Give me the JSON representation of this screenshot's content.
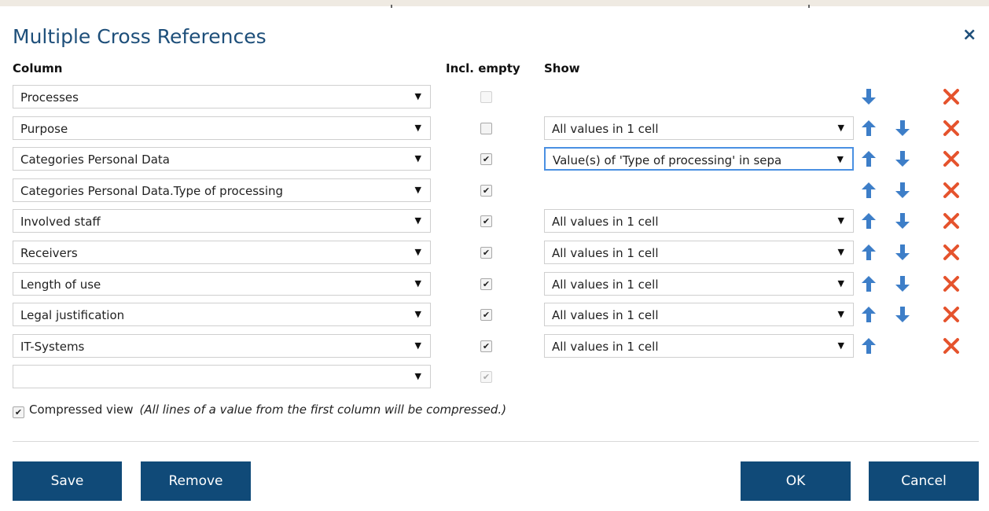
{
  "dialog": {
    "title": "Multiple Cross References",
    "close_glyph": "×"
  },
  "headers": {
    "column": "Column",
    "incl_empty": "Incl. empty",
    "show": "Show"
  },
  "rows": [
    {
      "column": "Processes",
      "incl_empty": false,
      "incl_disabled": true,
      "show": "",
      "up": false,
      "down": true
    },
    {
      "column": "Purpose",
      "incl_empty": false,
      "incl_disabled": false,
      "show": "All values in 1 cell",
      "up": true,
      "down": true
    },
    {
      "column": "Categories Personal Data",
      "incl_empty": true,
      "incl_disabled": false,
      "show": "Value(s) of 'Type of processing' in sepa",
      "show_focused": true,
      "up": true,
      "down": true
    },
    {
      "column": "Categories Personal Data.Type of processing",
      "incl_empty": true,
      "incl_disabled": false,
      "show": "",
      "up": true,
      "down": true
    },
    {
      "column": "Involved staff",
      "incl_empty": true,
      "incl_disabled": false,
      "show": "All values in 1 cell",
      "up": true,
      "down": true
    },
    {
      "column": "Receivers",
      "incl_empty": true,
      "incl_disabled": false,
      "show": "All values in 1 cell",
      "up": true,
      "down": true
    },
    {
      "column": "Length of use",
      "incl_empty": true,
      "incl_disabled": false,
      "show": "All values in 1 cell",
      "up": true,
      "down": true
    },
    {
      "column": "Legal justification",
      "incl_empty": true,
      "incl_disabled": false,
      "show": "All values in 1 cell",
      "up": true,
      "down": true
    },
    {
      "column": "IT-Systems",
      "incl_empty": true,
      "incl_disabled": false,
      "show": "All values in 1 cell",
      "up": true,
      "down": false
    },
    {
      "column": "",
      "incl_empty": true,
      "incl_disabled": true,
      "show": "",
      "up": false,
      "down": false,
      "no_delete": true
    }
  ],
  "compressed": {
    "checked": true,
    "label": "Compressed view",
    "note": "(All lines of a value from the first column will be compressed.)"
  },
  "buttons": {
    "save": "Save",
    "remove": "Remove",
    "ok": "OK",
    "cancel": "Cancel"
  },
  "icons": {
    "select_arrow": "▼",
    "check_mark": "✔"
  },
  "colors": {
    "title": "#1e4f7a",
    "arrow": "#3d7ec8",
    "delete": "#e5532d",
    "button": "#104a78"
  }
}
